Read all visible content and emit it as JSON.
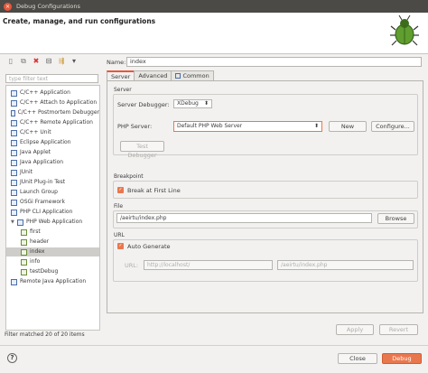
{
  "window": {
    "title": "Debug Configurations",
    "close_glyph": "×"
  },
  "banner": {
    "title": "Create, manage, and run configurations"
  },
  "left": {
    "toolbar": [
      {
        "name": "new-config-icon",
        "glyph": "▯"
      },
      {
        "name": "duplicate-icon",
        "glyph": "⧉"
      },
      {
        "name": "delete-icon",
        "glyph": "✖"
      },
      {
        "name": "collapse-icon",
        "glyph": "⊟"
      },
      {
        "name": "filter-icon",
        "glyph": "⇶"
      },
      {
        "name": "dropdown-icon",
        "glyph": "▾"
      }
    ],
    "filter_placeholder": "type filter text",
    "tree": [
      {
        "label": "C/C++ Application",
        "level": 0
      },
      {
        "label": "C/C++ Attach to Application",
        "level": 0
      },
      {
        "label": "C/C++ Postmortem Debugger",
        "level": 0
      },
      {
        "label": "C/C++ Remote Application",
        "level": 0
      },
      {
        "label": "C/C++ Unit",
        "level": 0
      },
      {
        "label": "Eclipse Application",
        "level": 0
      },
      {
        "label": "Java Applet",
        "level": 0
      },
      {
        "label": "Java Application",
        "level": 0
      },
      {
        "label": "JUnit",
        "level": 0
      },
      {
        "label": "JUnit Plug-in Test",
        "level": 0
      },
      {
        "label": "Launch Group",
        "level": 0
      },
      {
        "label": "OSGi Framework",
        "level": 0
      },
      {
        "label": "PHP CLI Application",
        "level": 0
      },
      {
        "label": "PHP Web Application",
        "level": 0,
        "expanded": true
      },
      {
        "label": "first",
        "level": 1
      },
      {
        "label": "header",
        "level": 1
      },
      {
        "label": "index",
        "level": 1,
        "selected": true
      },
      {
        "label": "info",
        "level": 1
      },
      {
        "label": "testDebug",
        "level": 1
      },
      {
        "label": "Remote Java Application",
        "level": 0
      }
    ],
    "status": "Filter matched 20 of 20 items"
  },
  "right": {
    "name_label": "Name:",
    "name_value": "index",
    "tabs": [
      {
        "label": "Server",
        "active": true
      },
      {
        "label": "Advanced",
        "active": false
      },
      {
        "label": "Common",
        "active": false
      }
    ],
    "server": {
      "group_label": "Server",
      "debugger_label": "Server Debugger:",
      "debugger_value": "XDebug",
      "php_server_label": "PHP Server:",
      "php_server_value": "Default PHP Web Server",
      "new_button": "New",
      "configure_button": "Configure...",
      "test_button": "Test Debugger"
    },
    "breakpoint": {
      "group_label": "Breakpoint",
      "check_label": "Break at First Line",
      "checked": true
    },
    "file": {
      "group_label": "File",
      "value": "/aeirtu/index.php",
      "browse_button": "Browse"
    },
    "url": {
      "group_label": "URL",
      "check_label": "Auto Generate",
      "checked": true,
      "url_label": "URL:",
      "url_host": "http://localhost/",
      "url_path": "/aeirtu/index.php"
    },
    "apply_button": "Apply",
    "revert_button": "Revert"
  },
  "footer": {
    "help_glyph": "?",
    "close_button": "Close",
    "debug_button": "Debug"
  },
  "colors": {
    "accent": "#e9774e",
    "titlebar": "#4b4a47"
  }
}
